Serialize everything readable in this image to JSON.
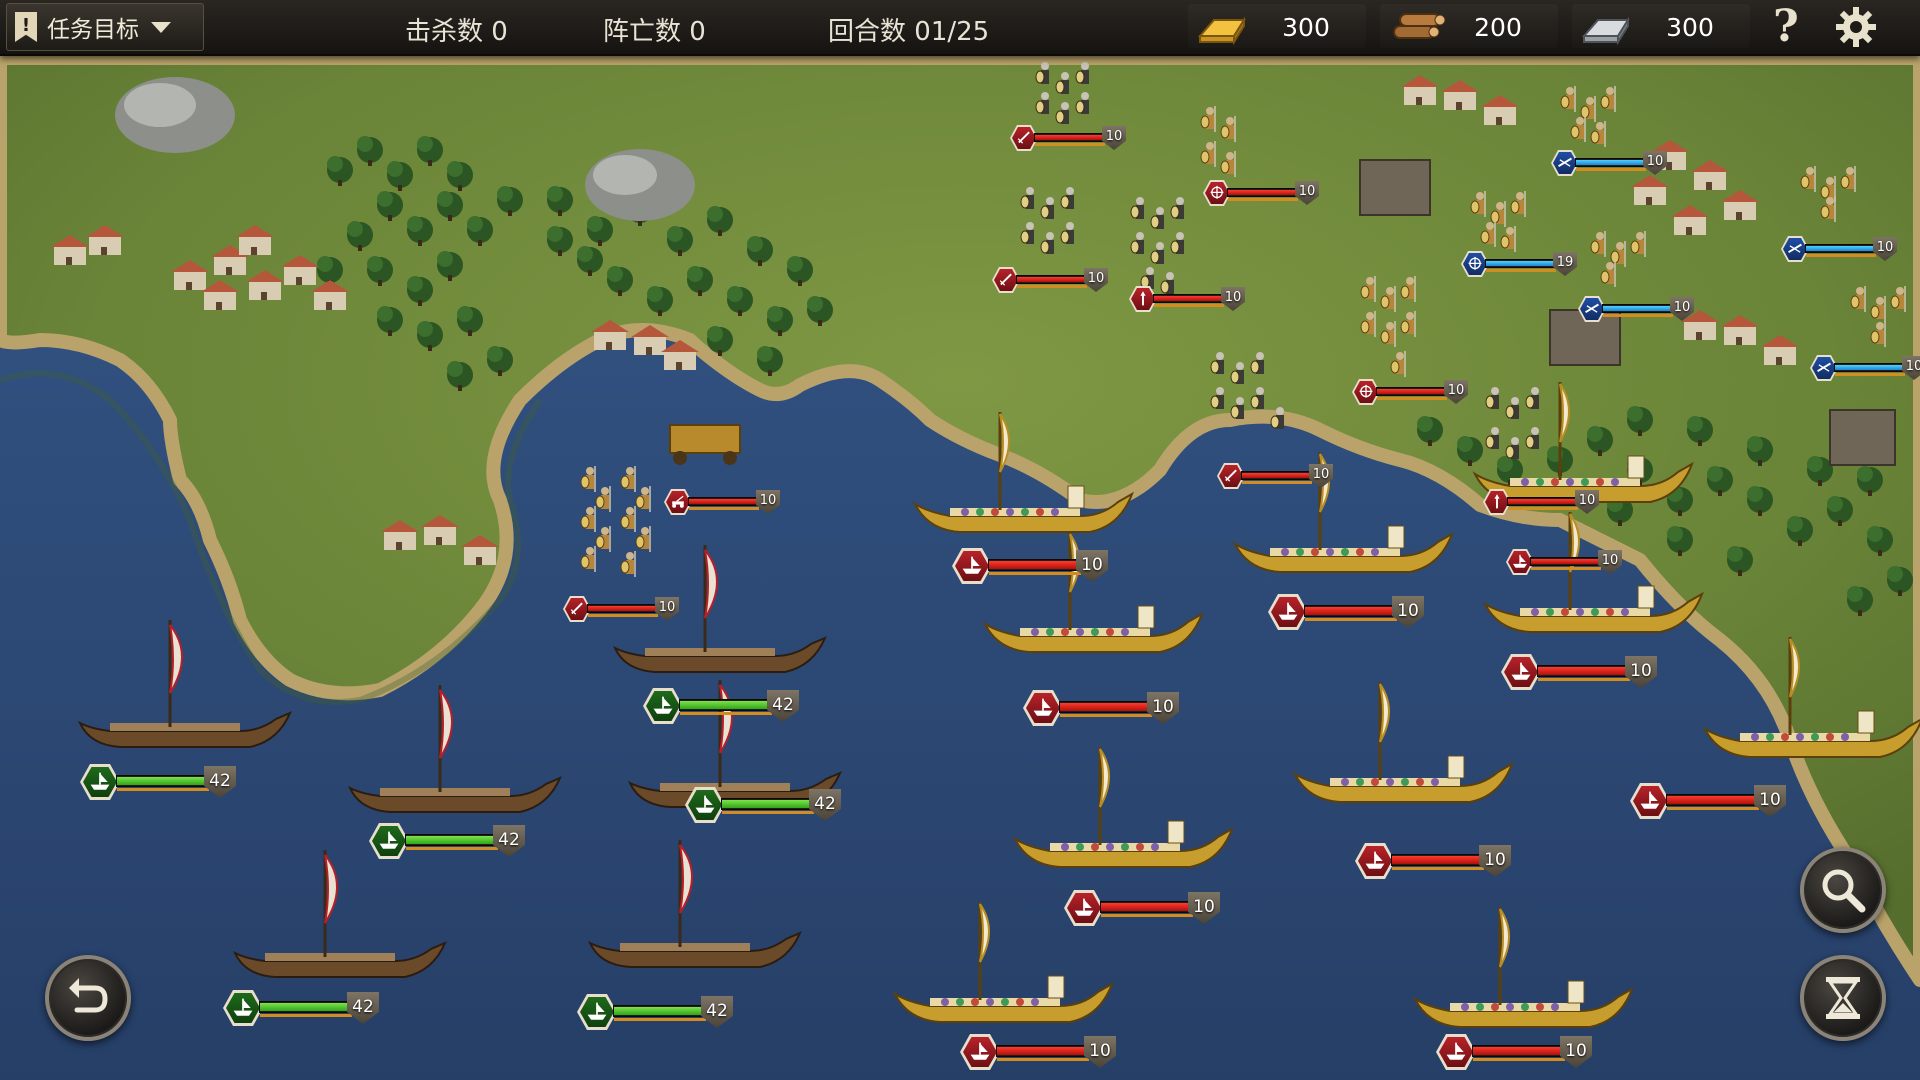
{
  "hud": {
    "mission_label": "任务目标",
    "mission_flag_glyph": "!",
    "kills_label": "击杀数",
    "kills_value": "0",
    "deaths_label": "阵亡数",
    "deaths_value": "0",
    "rounds_label": "回合数",
    "rounds_value": "01/25",
    "gold": "300",
    "wood": "200",
    "iron": "300",
    "help_glyph": "?",
    "colors": {
      "hud_bg": "#1b1916",
      "text": "#e8e3d4"
    }
  },
  "map": {
    "colors": {
      "sea": "#2c4a74",
      "land": "#6f8a3a",
      "shore": "#b9a36b",
      "forest": "#2f5a26",
      "roof": "#b5573a"
    }
  },
  "friendly_ships": [
    {
      "icon": "ship-icon",
      "health": "42",
      "hp_fraction": 1.0
    },
    {
      "icon": "ship-icon",
      "health": "42",
      "hp_fraction": 1.0
    },
    {
      "icon": "ship-icon",
      "health": "42",
      "hp_fraction": 1.0
    },
    {
      "icon": "ship-icon",
      "health": "42",
      "hp_fraction": 1.0
    },
    {
      "icon": "ship-icon",
      "health": "42",
      "hp_fraction": 1.0
    },
    {
      "icon": "ship-icon",
      "health": "42",
      "hp_fraction": 1.0
    }
  ],
  "enemy_ships": [
    {
      "icon": "ship-icon",
      "health": "10",
      "hp_fraction": 1.0
    },
    {
      "icon": "ship-icon",
      "health": "10",
      "hp_fraction": 1.0
    },
    {
      "icon": "ship-icon",
      "health": "10",
      "hp_fraction": 1.0
    },
    {
      "icon": "ship-icon",
      "health": "10",
      "hp_fraction": 1.0
    },
    {
      "icon": "ship-icon",
      "health": "10",
      "hp_fraction": 1.0
    },
    {
      "icon": "ship-icon",
      "health": "10",
      "hp_fraction": 1.0
    },
    {
      "icon": "ship-icon",
      "health": "10",
      "hp_fraction": 1.0
    },
    {
      "icon": "ship-icon",
      "health": "10",
      "hp_fraction": 1.0
    },
    {
      "icon": "ship-icon",
      "health": "10",
      "hp_fraction": 1.0
    },
    {
      "icon": "ship-icon",
      "health": "10",
      "hp_fraction": 1.0
    }
  ],
  "enemy_land_units": [
    {
      "icon": "sword-icon",
      "health": "10",
      "hp_fraction": 1.0
    },
    {
      "icon": "archer-icon",
      "health": "10",
      "hp_fraction": 1.0
    },
    {
      "icon": "sword-icon",
      "health": "10",
      "hp_fraction": 1.0
    },
    {
      "icon": "spear-icon",
      "health": "10",
      "hp_fraction": 1.0
    },
    {
      "icon": "archer-icon",
      "health": "10",
      "hp_fraction": 1.0
    },
    {
      "icon": "sword-icon",
      "health": "10",
      "hp_fraction": 1.0
    },
    {
      "icon": "spear-icon",
      "health": "10",
      "hp_fraction": 1.0
    },
    {
      "icon": "catapult-icon",
      "health": "10",
      "hp_fraction": 1.0
    },
    {
      "icon": "sword-icon",
      "health": "10",
      "hp_fraction": 1.0
    }
  ],
  "allied_units": [
    {
      "icon": "cavalry-icon",
      "health": "10",
      "hp_fraction": 1.0
    },
    {
      "icon": "archer-icon",
      "health": "19",
      "hp_fraction": 1.0
    },
    {
      "icon": "cavalry-icon",
      "health": "10",
      "hp_fraction": 1.0
    },
    {
      "icon": "cavalry-icon",
      "health": "10",
      "hp_fraction": 1.0
    },
    {
      "icon": "cavalry-icon",
      "health": "10",
      "hp_fraction": 1.0
    }
  ],
  "buttons": {
    "undo": "undo-icon",
    "inspect": "magnifier-icon",
    "end_turn": "hourglass-icon",
    "settings": "gear-icon",
    "help": "help-icon"
  }
}
